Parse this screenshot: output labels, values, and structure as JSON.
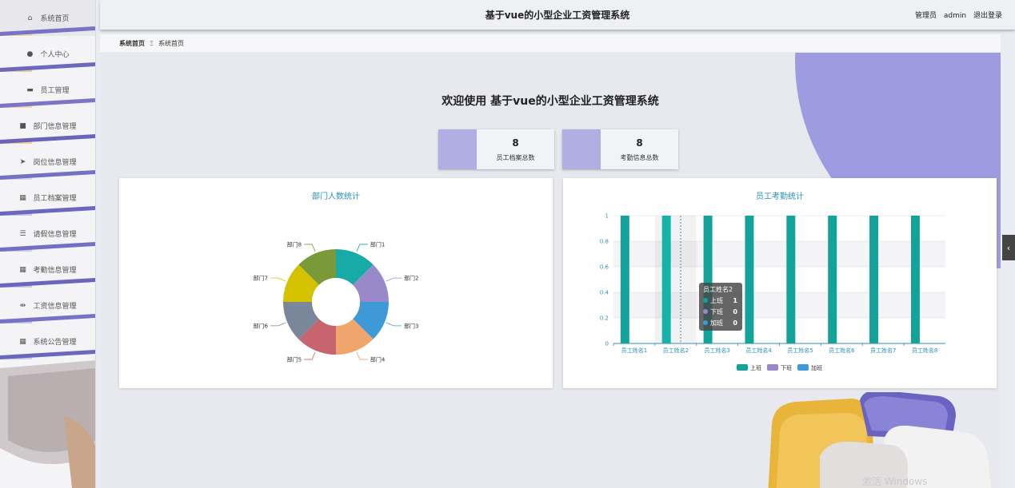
{
  "sidebar": {
    "items": [
      {
        "label": "系统首页",
        "icon": "home-icon",
        "glyph": "⌂"
      },
      {
        "label": "个人中心",
        "icon": "user-icon",
        "glyph": "●"
      },
      {
        "label": "员工管理",
        "icon": "chat-icon",
        "glyph": "▬"
      },
      {
        "label": "部门信息管理",
        "icon": "folder-icon",
        "glyph": "■"
      },
      {
        "label": "岗位信息管理",
        "icon": "send-icon",
        "glyph": "➤"
      },
      {
        "label": "员工档案管理",
        "icon": "grid-icon",
        "glyph": "▦"
      },
      {
        "label": "请假信息管理",
        "icon": "list-icon",
        "glyph": "☰"
      },
      {
        "label": "考勤信息管理",
        "icon": "grid-icon",
        "glyph": "▦"
      },
      {
        "label": "工资信息管理",
        "icon": "sliders-icon",
        "glyph": "⇹"
      },
      {
        "label": "系统公告管理",
        "icon": "grid-icon",
        "glyph": "▦"
      }
    ]
  },
  "header": {
    "title": "基于vue的小型企业工资管理系统",
    "user_role": "管理员",
    "username": "admin",
    "logout": "退出登录"
  },
  "breadcrumb": {
    "home": "系统首页",
    "separator": "Ξ",
    "current": "系统首页"
  },
  "welcome": "欢迎使用 基于vue的小型企业工资管理系统",
  "stats": [
    {
      "value": "8",
      "label": "员工档案总数"
    },
    {
      "value": "8",
      "label": "考勤信息总数"
    }
  ],
  "pie_card": {
    "title": "部门人数统计"
  },
  "bar_card": {
    "title": "员工考勤统计"
  },
  "collapse_handle": "‹",
  "watermark": "激活 Windows",
  "colors": {
    "accent_purple": "#9e9ce0",
    "title_blue": "#2a8fb8",
    "teal": "#14a39b"
  },
  "chart_data": [
    {
      "type": "pie",
      "title": "部门人数统计",
      "donut": true,
      "categories": [
        "部门1",
        "部门2",
        "部门3",
        "部门4",
        "部门5",
        "部门6",
        "部门7",
        "部门8"
      ],
      "values": [
        1,
        1,
        1,
        1,
        1,
        1,
        1,
        1
      ],
      "colors": [
        "#18aaa6",
        "#9a89c8",
        "#3e9ad7",
        "#f0a56c",
        "#c6656d",
        "#7a869a",
        "#d4c100",
        "#7a9a3a"
      ]
    },
    {
      "type": "bar",
      "title": "员工考勤统计",
      "categories": [
        "员工姓名1",
        "员工姓名2",
        "员工姓名3",
        "员工姓名4",
        "员工姓名5",
        "员工姓名6",
        "员工姓名7",
        "员工姓名8"
      ],
      "series": [
        {
          "name": "上班",
          "values": [
            1,
            1,
            1,
            1,
            1,
            1,
            1,
            1
          ],
          "color": "#14a39b"
        },
        {
          "name": "下班",
          "values": [
            0,
            0,
            0,
            0,
            0,
            0,
            0,
            0
          ],
          "color": "#9a89c8"
        },
        {
          "name": "加班",
          "values": [
            0,
            0,
            0,
            0,
            0,
            0,
            0,
            0
          ],
          "color": "#3e9ad7"
        }
      ],
      "ylim": [
        0,
        1
      ],
      "yticks": [
        "0",
        "0.2",
        "0.4",
        "0.6",
        "0.8",
        "1"
      ],
      "grid": true,
      "legend": "bottom-center",
      "tooltip": {
        "category": "员工姓名2",
        "rows": [
          {
            "name": "上班",
            "value": "1"
          },
          {
            "name": "下班",
            "value": "0"
          },
          {
            "name": "加班",
            "value": "0"
          }
        ]
      }
    }
  ]
}
